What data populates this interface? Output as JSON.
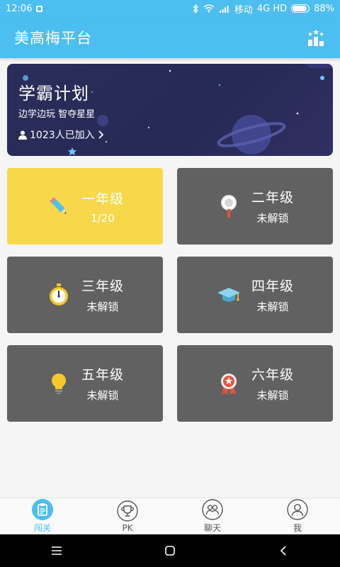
{
  "status_bar": {
    "time": "12:06",
    "carrier": "移动",
    "network": "4G HD",
    "battery": "88%",
    "battery_level": 0.88
  },
  "app_bar": {
    "title": "美高梅平台",
    "ranking_icon": "ranking-icon"
  },
  "banner": {
    "title": "学霸计划",
    "subtitle": "边学边玩 智夺星星",
    "joined": "1023人已加入",
    "person_icon": "person-icon",
    "arrow_icon": "chevron-right-icon"
  },
  "grades": [
    {
      "name": "一年级",
      "status": "1/20",
      "icon": "pencil-icon",
      "active": true
    },
    {
      "name": "二年级",
      "status": "未解锁",
      "icon": "magnifier-icon",
      "active": false
    },
    {
      "name": "三年级",
      "status": "未解锁",
      "icon": "stopwatch-icon",
      "active": false
    },
    {
      "name": "四年级",
      "status": "未解锁",
      "icon": "graduation-cap-icon",
      "active": false
    },
    {
      "name": "五年级",
      "status": "未解锁",
      "icon": "lightbulb-icon",
      "active": false
    },
    {
      "name": "六年级",
      "status": "未解锁",
      "icon": "medal-icon",
      "active": false
    }
  ],
  "colors": {
    "primary": "#4cbef0",
    "active_card": "#f6d84a",
    "locked_card": "#616161",
    "banner_bg": "#2b2c5a"
  },
  "tabs": [
    {
      "label": "闯关",
      "icon": "clipboard-icon",
      "active": true
    },
    {
      "label": "PK",
      "icon": "trophy-icon",
      "active": false
    },
    {
      "label": "聊天",
      "icon": "chat-icon",
      "active": false
    },
    {
      "label": "我",
      "icon": "user-icon",
      "active": false
    }
  ],
  "nav_bar": {
    "menu_icon": "menu-icon",
    "home_icon": "home-icon",
    "back_icon": "back-icon"
  }
}
